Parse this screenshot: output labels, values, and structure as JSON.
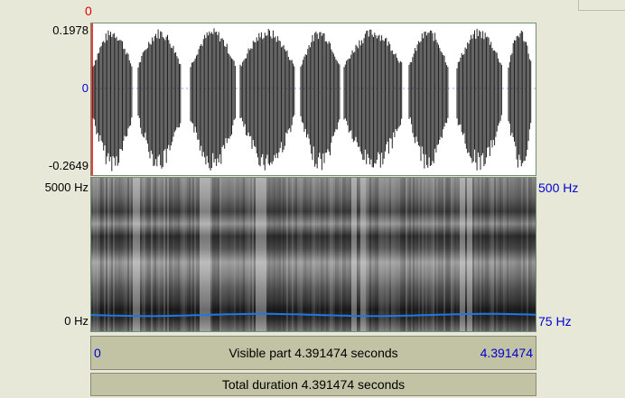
{
  "cursor": {
    "time_label": "0"
  },
  "waveform": {
    "max_label": "0.1978",
    "zero_label": "0",
    "min_label": "-0.2649"
  },
  "spectrogram": {
    "max_freq_label": "5000 Hz",
    "min_freq_label": "0 Hz"
  },
  "pitch": {
    "max_label": "500 Hz",
    "min_label": "75 Hz",
    "line_color": "#1e78e6"
  },
  "visible_part": {
    "start": "0",
    "label": "Visible part 4.391474 seconds",
    "end": "4.391474"
  },
  "total_duration": {
    "label": "Total duration 4.391474 seconds"
  },
  "colors": {
    "background": "#e8e8d8",
    "bar": "#c2c2a4",
    "axis_blue": "#0000d0",
    "cursor_red": "#e00000"
  }
}
